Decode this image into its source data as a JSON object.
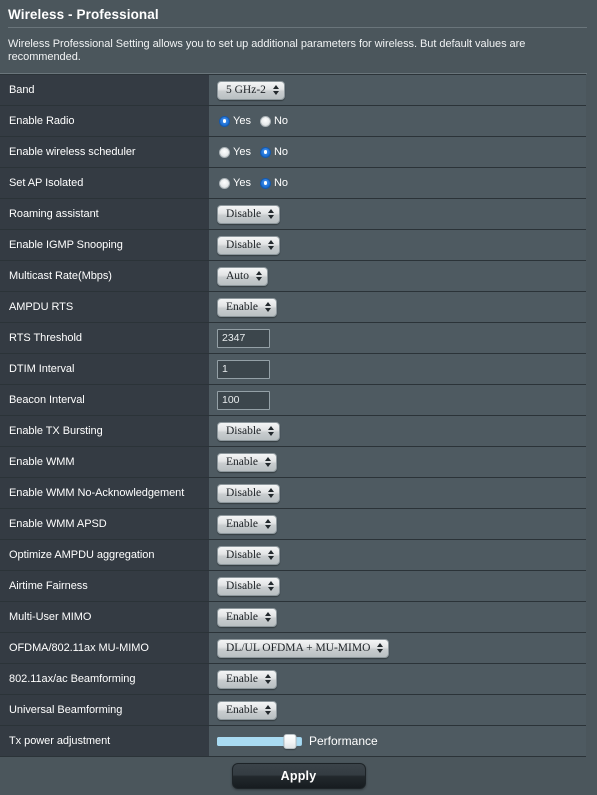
{
  "header": {
    "title": "Wireless - Professional",
    "description": "Wireless Professional Setting allows you to set up additional parameters for wireless. But default values are recommended."
  },
  "colors": {
    "page_bg": "#4b565c",
    "label_cell_bg": "#343b43",
    "value_cell_bg": "#4e5a61",
    "row_divider": "#2b3338",
    "radio_selected": "#1f72d6",
    "slider_track": "#a9dbf2",
    "text": "#ffffff"
  },
  "rows": [
    {
      "label": "Band",
      "control": "select",
      "value": "5 GHz-2"
    },
    {
      "label": "Enable Radio",
      "control": "radio",
      "options": [
        "Yes",
        "No"
      ],
      "selected": "Yes"
    },
    {
      "label": "Enable wireless scheduler",
      "control": "radio",
      "options": [
        "Yes",
        "No"
      ],
      "selected": "No"
    },
    {
      "label": "Set AP Isolated",
      "control": "radio",
      "options": [
        "Yes",
        "No"
      ],
      "selected": "No"
    },
    {
      "label": "Roaming assistant",
      "control": "select",
      "value": "Disable"
    },
    {
      "label": "Enable IGMP Snooping",
      "control": "select",
      "value": "Disable"
    },
    {
      "label": "Multicast Rate(Mbps)",
      "control": "select",
      "value": "Auto"
    },
    {
      "label": "AMPDU RTS",
      "control": "select",
      "value": "Enable"
    },
    {
      "label": "RTS Threshold",
      "control": "text",
      "value": "2347"
    },
    {
      "label": "DTIM Interval",
      "control": "text",
      "value": "1"
    },
    {
      "label": "Beacon Interval",
      "control": "text",
      "value": "100"
    },
    {
      "label": "Enable TX Bursting",
      "control": "select",
      "value": "Disable"
    },
    {
      "label": "Enable WMM",
      "control": "select",
      "value": "Enable"
    },
    {
      "label": "Enable WMM No-Acknowledgement",
      "control": "select",
      "value": "Disable"
    },
    {
      "label": "Enable WMM APSD",
      "control": "select",
      "value": "Enable"
    },
    {
      "label": "Optimize AMPDU aggregation",
      "control": "select",
      "value": "Disable"
    },
    {
      "label": "Airtime Fairness",
      "control": "select",
      "value": "Disable"
    },
    {
      "label": "Multi-User MIMO",
      "control": "select",
      "value": "Enable"
    },
    {
      "label": "OFDMA/802.11ax MU-MIMO",
      "control": "select",
      "value": "DL/UL OFDMA + MU-MIMO"
    },
    {
      "label": "802.11ax/ac Beamforming",
      "control": "select",
      "value": "Enable"
    },
    {
      "label": "Universal Beamforming",
      "control": "select",
      "value": "Enable"
    },
    {
      "label": "Tx power adjustment",
      "control": "slider",
      "value": "Performance",
      "percent": 86
    }
  ],
  "footer": {
    "apply_label": "Apply"
  }
}
